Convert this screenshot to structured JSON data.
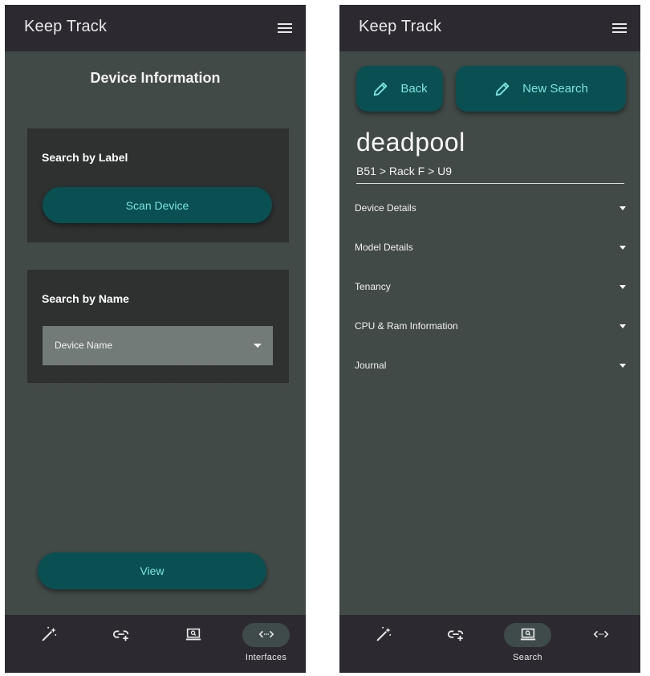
{
  "left_screen": {
    "app_title": "Keep Track",
    "menu_icon": "hamburger-menu-icon",
    "section_title": "Device Information",
    "search_by_label": {
      "title": "Search by Label",
      "button_label": "Scan Device"
    },
    "search_by_name": {
      "title": "Search by Name",
      "select_value": "Device Name"
    },
    "view_button_label": "View",
    "nav": [
      {
        "icon": "magic-wand-icon",
        "label": ""
      },
      {
        "icon": "link-add-icon",
        "label": ""
      },
      {
        "icon": "laptop-search-icon",
        "label": ""
      },
      {
        "icon": "code-arrows-icon",
        "label": "Interfaces",
        "active": true
      }
    ]
  },
  "right_screen": {
    "app_title": "Keep Track",
    "menu_icon": "hamburger-menu-icon",
    "back_label": "Back",
    "new_search_label": "New Search",
    "device_name": "deadpool",
    "device_location": "B51 > Rack F  > U9",
    "sections": [
      "Device Details",
      "Model Details",
      "Tenancy",
      "CPU & Ram Information",
      "Journal"
    ],
    "nav": [
      {
        "icon": "magic-wand-icon",
        "label": ""
      },
      {
        "icon": "link-add-icon",
        "label": ""
      },
      {
        "icon": "laptop-search-icon",
        "label": "Search",
        "active": true
      },
      {
        "icon": "code-arrows-icon",
        "label": ""
      }
    ]
  },
  "colors": {
    "appbar": "#2c2a30",
    "background": "#414a47",
    "card": "#2f3131",
    "accent_button": "#0a4f52",
    "accent_text": "#78e6df",
    "nav_active_indicator": "#3f4a4b"
  }
}
